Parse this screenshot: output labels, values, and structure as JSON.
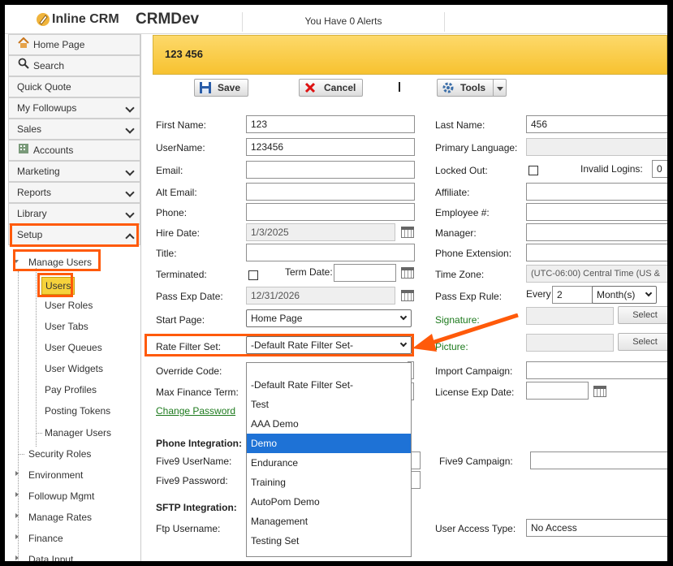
{
  "topbar": {
    "logo": "Inline CRM",
    "title": "CRMDev",
    "alerts": "You Have 0 Alerts"
  },
  "sidebar": {
    "items": [
      {
        "label": "Home Page",
        "icon": "home-icon"
      },
      {
        "label": "Search",
        "icon": "search-icon"
      },
      {
        "label": "Quick Quote"
      },
      {
        "label": "My Followups"
      },
      {
        "label": "Sales"
      },
      {
        "label": "Accounts",
        "icon": "building-icon"
      },
      {
        "label": "Marketing"
      },
      {
        "label": "Reports"
      },
      {
        "label": "Library"
      },
      {
        "label": "Setup"
      }
    ],
    "manage_users": "Manage Users",
    "sub_items": [
      "Users",
      "User Roles",
      "User Tabs",
      "User Queues",
      "User Widgets",
      "Pay Profiles",
      "Posting Tokens",
      "Manager Users"
    ],
    "tree_items": [
      "Security Roles",
      "Environment",
      "Followup Mgmt",
      "Manage Rates",
      "Finance",
      "Data Input"
    ]
  },
  "banner": {
    "title": "123 456"
  },
  "toolbar": {
    "save": "Save",
    "cancel": "Cancel",
    "tools": "Tools"
  },
  "form": {
    "first_name_label": "First Name:",
    "first_name": "123",
    "username_label": "UserName:",
    "username": "123456",
    "email_label": "Email:",
    "alt_email_label": "Alt Email:",
    "phone_label": "Phone:",
    "hire_date_label": "Hire Date:",
    "hire_date": "1/3/2025",
    "title_label": "Title:",
    "terminated_label": "Terminated:",
    "term_date_label": "Term Date:",
    "pass_exp_date_label": "Pass Exp Date:",
    "pass_exp_date": "12/31/2026",
    "start_page_label": "Start Page:",
    "start_page": "Home Page",
    "rate_filter_label": "Rate Filter Set:",
    "rate_filter": "-Default Rate Filter Set-",
    "override_code_label": "Override Code:",
    "max_finance_label": "Max Finance Term:",
    "change_password": "Change Password",
    "last_name_label": "Last Name:",
    "last_name": "456",
    "primary_language_label": "Primary Language:",
    "locked_out_label": "Locked Out:",
    "invalid_logins_label": "Invalid Logins:",
    "invalid_logins": "0",
    "affiliate_label": "Affiliate:",
    "employee_label": "Employee #:",
    "manager_label": "Manager:",
    "phone_ext_label": "Phone Extension:",
    "time_zone_label": "Time Zone:",
    "time_zone": "(UTC-06:00) Central Time (US &",
    "pass_exp_rule_label": "Pass Exp Rule:",
    "every": "Every",
    "every_value": "2",
    "every_unit": "Month(s)",
    "signature_label": "Signature:",
    "select": "Select",
    "picture_label": "Picture:",
    "import_campaign_label": "Import Campaign:",
    "license_exp_label": "License Exp Date:",
    "phone_integration": "Phone Integration:",
    "five9_username_label": "Five9 UserName:",
    "five9_password_label": "Five9 Password:",
    "five9_campaign_label": "Five9 Campaign:",
    "sftp_integration": "SFTP Integration:",
    "ftp_username_label": "Ftp Username:",
    "user_access_type_label": "User Access Type:",
    "user_access_type": "No Access"
  },
  "dropdown": {
    "options": [
      "-Default Rate Filter Set-",
      "Test",
      "AAA Demo",
      "Demo",
      "Endurance",
      "Training",
      "AutoPom Demo",
      "Management",
      "Testing Set"
    ],
    "active": "Demo"
  },
  "colors": {
    "highlight": "#ff5a0a",
    "banner": "#f7c230",
    "selected_option": "#1e72d6",
    "active_nav": "#f6d23c"
  }
}
